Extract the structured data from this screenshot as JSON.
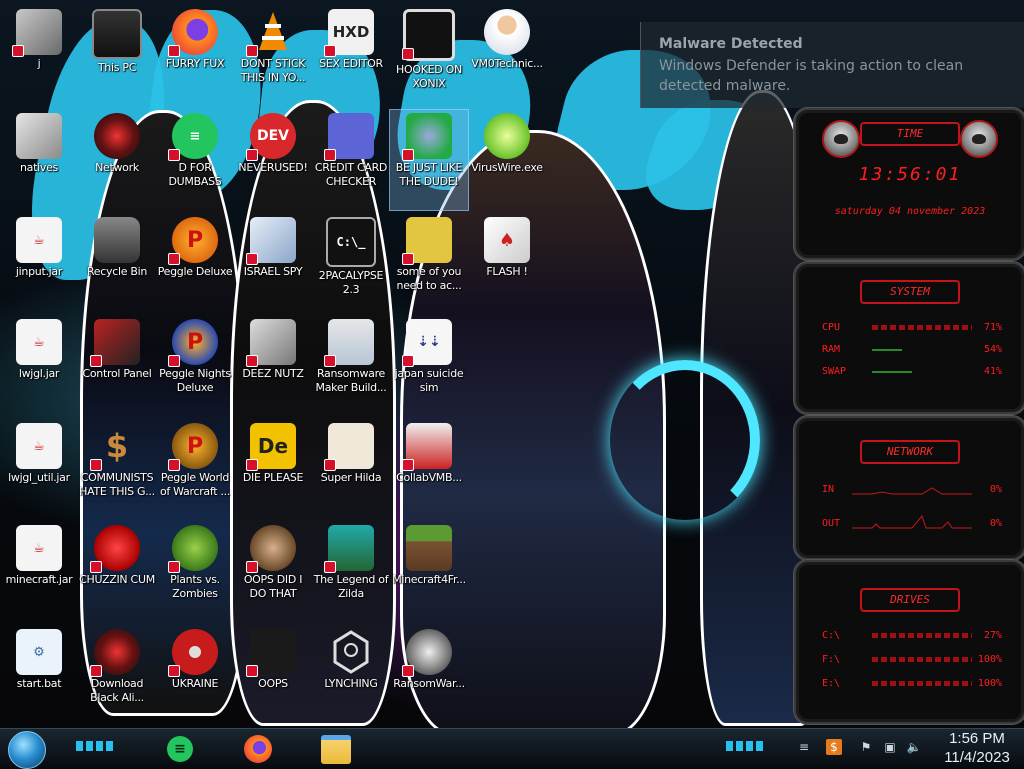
{
  "notification": {
    "title": "Malware Detected",
    "body": "Windows Defender is taking action to clean detected malware."
  },
  "desktop_icons": [
    {
      "label": "j"
    },
    {
      "label": "This PC"
    },
    {
      "label": "FURRY FUX"
    },
    {
      "label": "DONT STICK THIS IN YO..."
    },
    {
      "label": "SEX EDITOR"
    },
    {
      "label": "HOOKED ON XONIX"
    },
    {
      "label": "VM0Technic..."
    },
    {
      "label": "natives"
    },
    {
      "label": "Network"
    },
    {
      "label": "D FOR DUMBASS"
    },
    {
      "label": "NEVERUSED!"
    },
    {
      "label": "CREDIT CARD CHECKER"
    },
    {
      "label": "BE JUST LIKE THE DUDE!"
    },
    {
      "label": "VirusWire.exe"
    },
    {
      "label": "jinput.jar"
    },
    {
      "label": "Recycle Bin"
    },
    {
      "label": "Peggle Deluxe"
    },
    {
      "label": "ISRAEL SPY"
    },
    {
      "label": "2PACALYPSE 2.3"
    },
    {
      "label": "some of you need to ac..."
    },
    {
      "label": "FLASH !"
    },
    {
      "label": "lwjgl.jar"
    },
    {
      "label": "Control Panel"
    },
    {
      "label": "Peggle Nights Deluxe"
    },
    {
      "label": "DEEZ NUTZ"
    },
    {
      "label": "Ransomware Maker Build..."
    },
    {
      "label": "japan suicide sim"
    },
    {
      "label": "lwjgl_util.jar"
    },
    {
      "label": "COMMUNISTS HATE THIS G..."
    },
    {
      "label": "Peggle World of Warcraft ..."
    },
    {
      "label": "DIE PLEASE"
    },
    {
      "label": "Super Hilda"
    },
    {
      "label": "CollabVMB..."
    },
    {
      "label": "minecraft.jar"
    },
    {
      "label": "CHUZZIN CUM"
    },
    {
      "label": "Plants vs. Zombies"
    },
    {
      "label": "OOPS DID I DO THAT"
    },
    {
      "label": "The Legend of Zilda"
    },
    {
      "label": "Minecraft4Fr..."
    },
    {
      "label": "start.bat"
    },
    {
      "label": "Download Black Ali..."
    },
    {
      "label": "UKRAINE"
    },
    {
      "label": "OOPS"
    },
    {
      "label": "LYNCHING"
    },
    {
      "label": "RansomWar..."
    }
  ],
  "icon_badge_text": {
    "dev": "DEV",
    "de": "De"
  },
  "gadgets": {
    "time": {
      "title": "TIME",
      "clock": "13:56:01",
      "date": "saturday 04 november 2023"
    },
    "system": {
      "title": "SYSTEM",
      "rows": [
        {
          "key": "CPU",
          "value": "71%"
        },
        {
          "key": "RAM",
          "value": "54%"
        },
        {
          "key": "SWAP",
          "value": "41%"
        }
      ]
    },
    "network": {
      "title": "NETWORK",
      "rows": [
        {
          "key": "IN",
          "value": "0%"
        },
        {
          "key": "OUT",
          "value": "0%"
        }
      ]
    },
    "drives": {
      "title": "DRIVES",
      "rows": [
        {
          "key": "C:\\",
          "value": "27%"
        },
        {
          "key": "F:\\",
          "value": "100%"
        },
        {
          "key": "E:\\",
          "value": "100%"
        }
      ]
    }
  },
  "taskbar": {
    "time": "1:56 PM",
    "date": "11/4/2023",
    "pinned": [
      "chat-app-icon",
      "firefox-icon",
      "file-explorer-icon"
    ]
  },
  "colors": {
    "accent_red": "#ff1e1e",
    "accent_cyan": "#2bc2e8",
    "taskbar_bg": "#0a1016"
  }
}
